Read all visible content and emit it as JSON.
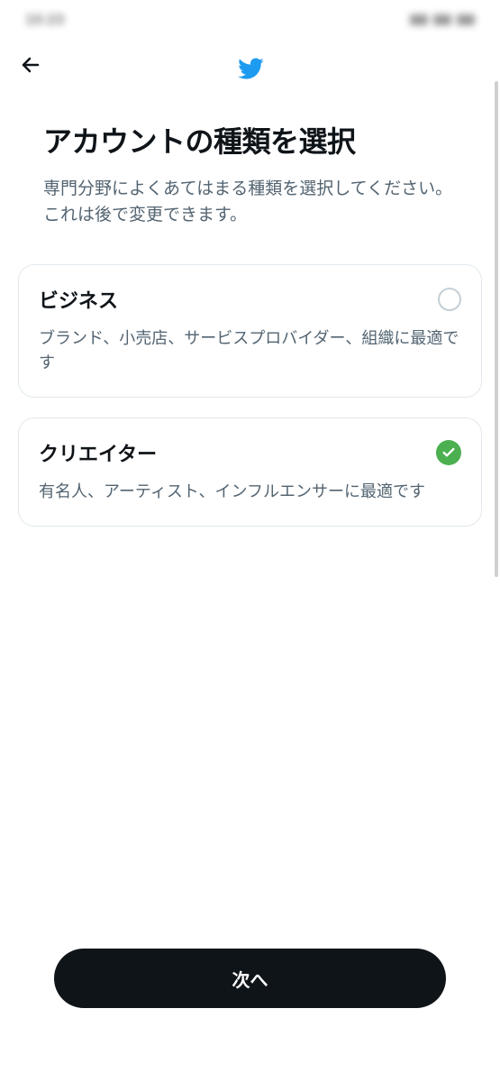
{
  "header": {
    "status_time": "10:23",
    "logo_name": "twitter-bird-icon"
  },
  "page": {
    "title": "アカウントの種類を選択",
    "subtitle": "専門分野によくあてはまる種類を選択してください。これは後で変更できます。"
  },
  "options": [
    {
      "title": "ビジネス",
      "description": "ブランド、小売店、サービスプロバイダー、組織に最適です",
      "selected": false
    },
    {
      "title": "クリエイター",
      "description": "有名人、アーティスト、インフルエンサーに最適です",
      "selected": true
    }
  ],
  "footer": {
    "next_label": "次へ"
  },
  "colors": {
    "twitter_blue": "#1d9bf0",
    "check_green": "#4caf50",
    "text_primary": "#0f1419",
    "text_secondary": "#536471"
  }
}
